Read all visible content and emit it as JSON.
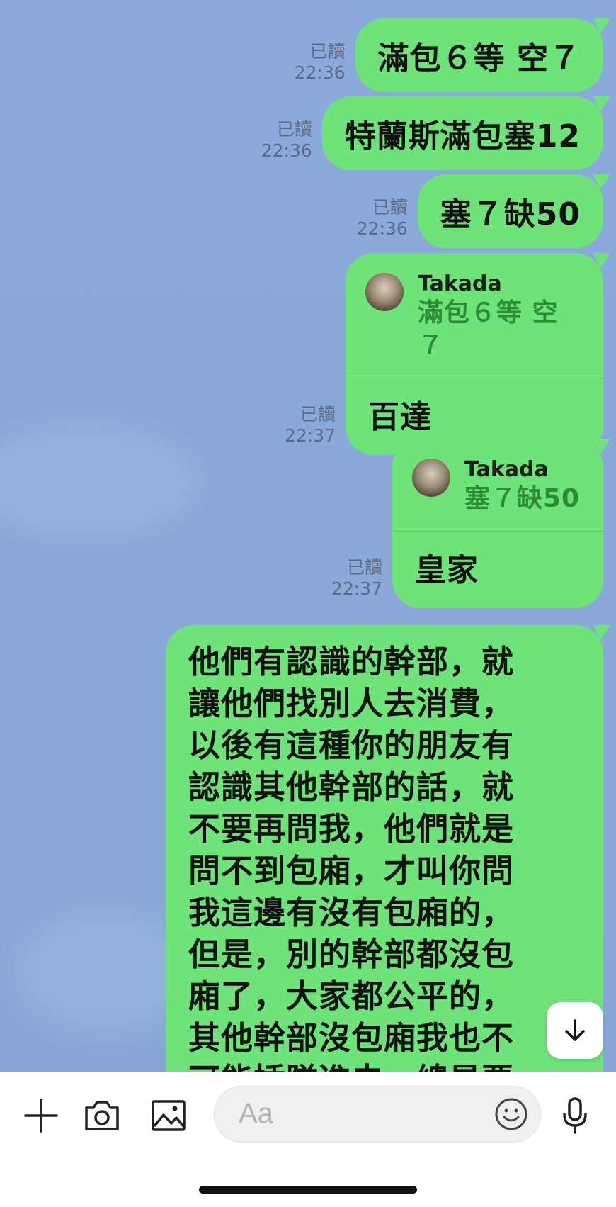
{
  "messages": [
    {
      "read": "已讀",
      "time": "22:36",
      "text": "滿包６等 空７"
    },
    {
      "read": "已讀",
      "time": "22:36",
      "text": "特蘭斯滿包塞12"
    },
    {
      "read": "已讀",
      "time": "22:36",
      "text": "塞７缺50"
    },
    {
      "read": "已讀",
      "time": "22:37",
      "reply_to": {
        "name": "Takada",
        "text": "滿包６等 空７"
      },
      "text": "百達"
    },
    {
      "read": "已讀",
      "time": "22:37",
      "reply_to": {
        "name": "Takada",
        "text": "塞７缺50"
      },
      "text": "皇家"
    },
    {
      "text_lines": [
        "他們有認識的幹部，就",
        "讓他們找別人去消費，",
        "以後有這種你的朋友有",
        "認識其他幹部的話，就",
        "不要再問我，他們就是",
        "問不到包廂，才叫你問",
        "我這邊有沒有包廂的，",
        "但是，別的幹部都沒包",
        "廂了，大家都公平的，",
        "其他幹部沒包廂我也不",
        "可能插隊進去，總是要"
      ]
    }
  ],
  "input": {
    "placeholder": "Aa"
  },
  "icons": {
    "plus": "plus-icon",
    "camera": "camera-icon",
    "image": "image-icon",
    "emoji": "emoji-icon",
    "mic": "microphone-icon",
    "scroll": "arrow-down-icon"
  },
  "colors": {
    "bubble": "#6ee37a",
    "background": "#8aa8d8",
    "quote_text": "#2e8b36"
  }
}
